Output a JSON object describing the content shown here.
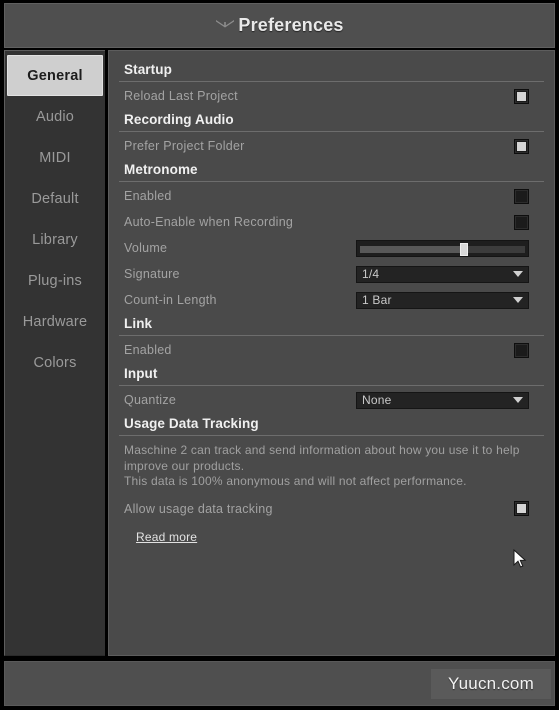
{
  "window": {
    "title": "Preferences",
    "logo_icon": "ni-wing-logo-icon"
  },
  "sidebar": {
    "items": [
      {
        "label": "General",
        "active": true
      },
      {
        "label": "Audio",
        "active": false
      },
      {
        "label": "MIDI",
        "active": false
      },
      {
        "label": "Default",
        "active": false
      },
      {
        "label": "Library",
        "active": false
      },
      {
        "label": "Plug-ins",
        "active": false
      },
      {
        "label": "Hardware",
        "active": false
      },
      {
        "label": "Colors",
        "active": false
      }
    ]
  },
  "sections": {
    "startup": {
      "heading": "Startup",
      "reload_last_project_label": "Reload Last Project",
      "reload_last_project_checked": true
    },
    "recording_audio": {
      "heading": "Recording Audio",
      "prefer_project_folder_label": "Prefer Project Folder",
      "prefer_project_folder_checked": true
    },
    "metronome": {
      "heading": "Metronome",
      "enabled_label": "Enabled",
      "enabled_checked": false,
      "auto_enable_label": "Auto-Enable when Recording",
      "auto_enable_checked": false,
      "volume_label": "Volume",
      "volume_percent": 63,
      "signature_label": "Signature",
      "signature_value": "1/4",
      "count_in_label": "Count-in Length",
      "count_in_value": "1 Bar"
    },
    "link": {
      "heading": "Link",
      "enabled_label": "Enabled",
      "enabled_checked": false
    },
    "input": {
      "heading": "Input",
      "quantize_label": "Quantize",
      "quantize_value": "None"
    },
    "usage_data_tracking": {
      "heading": "Usage Data Tracking",
      "description_line1": "Maschine 2 can track and send information about how you use it to help",
      "description_line2": "improve our products.",
      "description_line3": "This data is 100% anonymous and will not affect performance.",
      "allow_label": "Allow usage data tracking",
      "allow_checked": true,
      "read_more_label": "Read more"
    }
  },
  "watermark": {
    "text": "Yuucn.com"
  },
  "colors": {
    "window_chrome": "#4f4f4f",
    "sidebar_bg": "#333333",
    "panel_bg": "#4a4a4a",
    "active_tab_bg": "#cfcfcf",
    "label_text": "#a3a3a3",
    "heading_text": "#f0f0f0"
  }
}
